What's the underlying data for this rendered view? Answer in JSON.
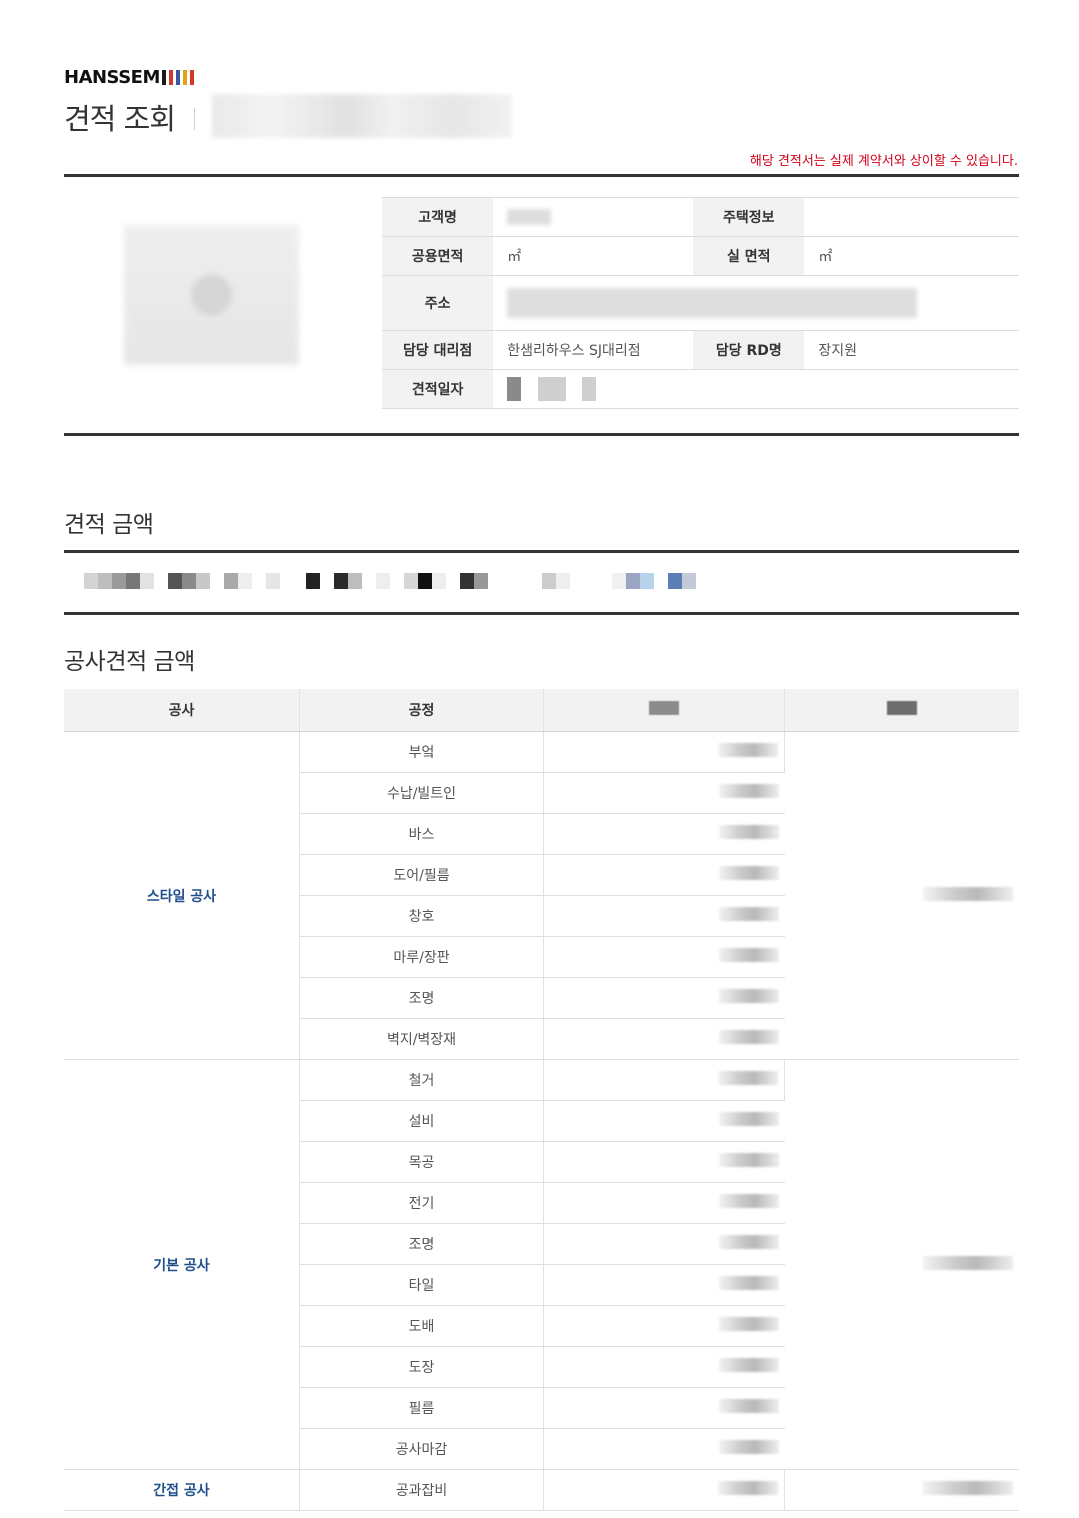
{
  "header": {
    "brand": "HANSSEM",
    "brand_bar_colors": [
      "#1b1b1b",
      "#d0392b",
      "#3b56a5",
      "#e0a419",
      "#d0392b"
    ],
    "title": "견적 조회",
    "notice": "해당 견적서는 실제 계약서와 상이할 수 있습니다."
  },
  "info": {
    "customer_label": "고객명",
    "housing_label": "주택정보",
    "common_area_label": "공용면적",
    "common_area_unit": "㎡",
    "real_area_label": "실 면적",
    "real_area_unit": "㎡",
    "address_label": "주소",
    "agency_label": "담당 대리점",
    "agency_value": "한샘리하우스 SJ대리점",
    "rd_label": "담당 RD명",
    "rd_value": "장지원",
    "date_label": "견적일자"
  },
  "sections": {
    "estimate_amount": "견적 금액",
    "construction_amount": "공사견적 금액"
  },
  "cost_table": {
    "headers": [
      "공사",
      "공정"
    ],
    "groups": [
      {
        "name": "스타일 공사",
        "items": [
          "부엌",
          "수납/빌트인",
          "바스",
          "도어/필름",
          "창호",
          "마루/장판",
          "조명",
          "벽지/벽장재"
        ]
      },
      {
        "name": "기본 공사",
        "items": [
          "철거",
          "설비",
          "목공",
          "전기",
          "조명",
          "타일",
          "도배",
          "도장",
          "필름",
          "공사마감"
        ]
      },
      {
        "name": "간접 공사",
        "items": [
          "공과잡비"
        ]
      }
    ]
  }
}
